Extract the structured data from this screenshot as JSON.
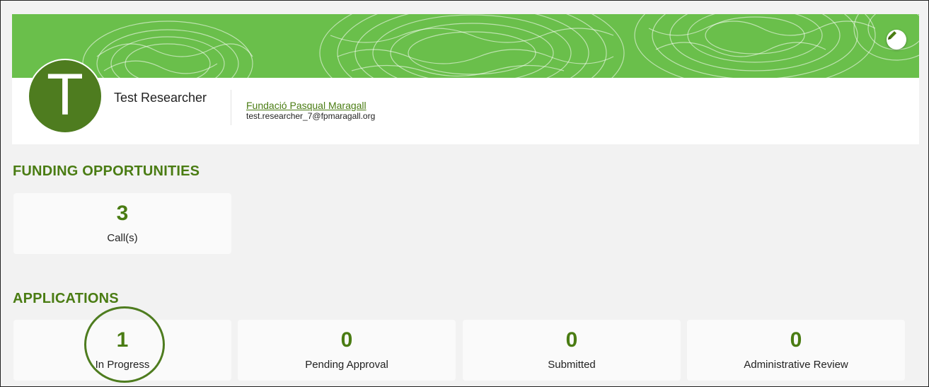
{
  "profile": {
    "avatar_letter": "T",
    "name": "Test Researcher",
    "organization": "Fundació Pasqual Maragall",
    "email": "test.researcher_7@fpmaragall.org",
    "edit_icon": "pencil-icon"
  },
  "funding": {
    "title": "FUNDING OPPORTUNITIES",
    "cards": [
      {
        "value": "3",
        "label": "Call(s)"
      }
    ]
  },
  "applications": {
    "title": "APPLICATIONS",
    "cards": [
      {
        "value": "1",
        "label": "In Progress"
      },
      {
        "value": "0",
        "label": "Pending Approval"
      },
      {
        "value": "0",
        "label": "Submitted"
      },
      {
        "value": "0",
        "label": "Administrative Review"
      }
    ]
  },
  "colors": {
    "brand_green": "#4a7c13",
    "banner_green": "#6abf4b",
    "avatar_green": "#4e7c1f",
    "background": "#f2f2f2"
  }
}
